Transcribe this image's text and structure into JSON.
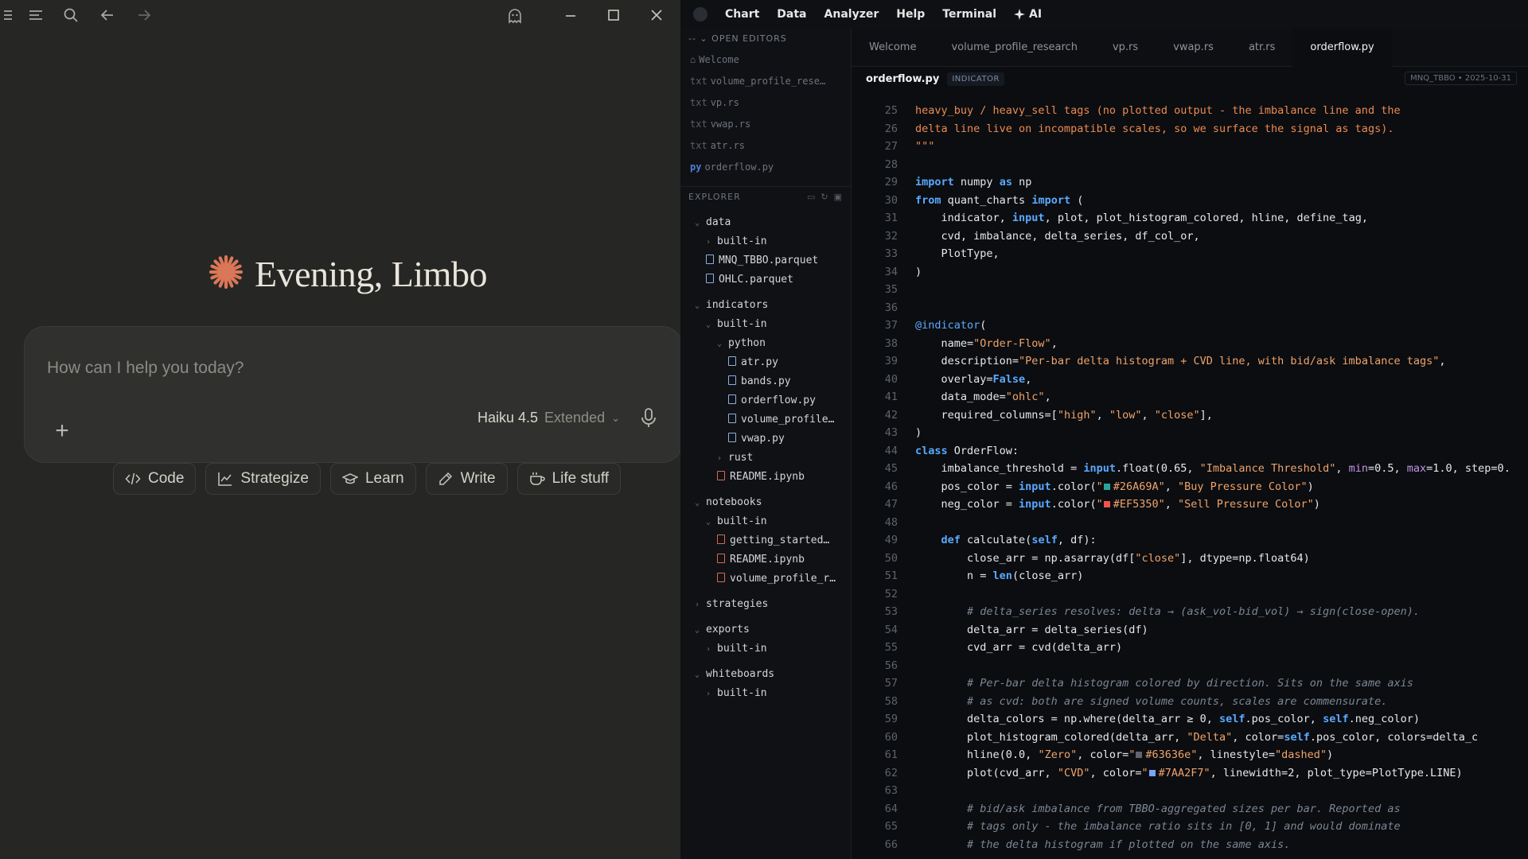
{
  "chat": {
    "greeting": "Evening, Limbo",
    "composer_placeholder": "How can I help you today?",
    "model_name": "Haiku 4.5",
    "model_mode": "Extended",
    "chips": [
      "Code",
      "Strategize",
      "Learn",
      "Write",
      "Life stuff"
    ],
    "accent_color": "#d97757"
  },
  "ide": {
    "menu": [
      "Chart",
      "Data",
      "Analyzer",
      "Help",
      "Terminal",
      "AI"
    ],
    "open_editors_label": "OPEN EDITORS",
    "open_editors": [
      {
        "prefix": "",
        "name": "Welcome"
      },
      {
        "prefix": "txt",
        "name": "volume_profile_rese…"
      },
      {
        "prefix": "txt",
        "name": "vp.rs"
      },
      {
        "prefix": "txt",
        "name": "vwap.rs"
      },
      {
        "prefix": "txt",
        "name": "atr.rs"
      },
      {
        "prefix": "py",
        "name": "orderflow.py"
      }
    ],
    "explorer_label": "EXPLORER",
    "tree": [
      {
        "name": "data",
        "indent": 0,
        "kind": "folder",
        "open": true
      },
      {
        "name": "built-in",
        "indent": 1,
        "kind": "folder",
        "open": false
      },
      {
        "name": "MNQ_TBBO.parquet",
        "indent": 1,
        "kind": "file"
      },
      {
        "name": "OHLC.parquet",
        "indent": 1,
        "kind": "file"
      },
      {
        "name": "indicators",
        "indent": 0,
        "kind": "folder",
        "open": true
      },
      {
        "name": "built-in",
        "indent": 1,
        "kind": "folder",
        "open": true
      },
      {
        "name": "python",
        "indent": 2,
        "kind": "folder",
        "open": true
      },
      {
        "name": "atr.py",
        "indent": 3,
        "kind": "file"
      },
      {
        "name": "bands.py",
        "indent": 3,
        "kind": "file"
      },
      {
        "name": "orderflow.py",
        "indent": 3,
        "kind": "file"
      },
      {
        "name": "volume_profile…",
        "indent": 3,
        "kind": "file"
      },
      {
        "name": "vwap.py",
        "indent": 3,
        "kind": "file"
      },
      {
        "name": "rust",
        "indent": 2,
        "kind": "folder",
        "open": false
      },
      {
        "name": "README.ipynb",
        "indent": 2,
        "kind": "nb"
      },
      {
        "name": "notebooks",
        "indent": 0,
        "kind": "folder",
        "open": true
      },
      {
        "name": "built-in",
        "indent": 1,
        "kind": "folder",
        "open": true
      },
      {
        "name": "getting_started…",
        "indent": 2,
        "kind": "nb"
      },
      {
        "name": "README.ipynb",
        "indent": 2,
        "kind": "nb"
      },
      {
        "name": "volume_profile_r…",
        "indent": 2,
        "kind": "nb"
      },
      {
        "name": "strategies",
        "indent": 0,
        "kind": "folder",
        "open": false
      },
      {
        "name": "exports",
        "indent": 0,
        "kind": "folder",
        "open": true
      },
      {
        "name": "built-in",
        "indent": 1,
        "kind": "folder",
        "open": false
      },
      {
        "name": "whiteboards",
        "indent": 0,
        "kind": "folder",
        "open": true
      },
      {
        "name": "built-in",
        "indent": 1,
        "kind": "folder",
        "open": false
      }
    ],
    "tabs": [
      "Welcome",
      "volume_profile_research",
      "vp.rs",
      "vwap.rs",
      "atr.rs",
      "orderflow.py"
    ],
    "active_tab": "orderflow.py",
    "breadcrumb_file": "orderflow.py",
    "breadcrumb_badge": "INDICATOR",
    "breadcrumb_meta": "MNQ_TBBO • 2025-10-31",
    "code_start_line": 25,
    "code_lines": [
      [
        [
          "doc",
          "heavy_buy / heavy_sell tags (no plotted output - the imbalance line and the"
        ]
      ],
      [
        [
          "doc",
          "delta line live on incompatible scales, so we surface the signal as tags)."
        ]
      ],
      [
        [
          "doc",
          "\"\"\""
        ]
      ],
      [],
      [
        [
          "k",
          "import"
        ],
        [
          "t",
          " numpy "
        ],
        [
          "k",
          "as"
        ],
        [
          "t",
          " np"
        ]
      ],
      [
        [
          "k",
          "from"
        ],
        [
          "t",
          " quant_charts "
        ],
        [
          "k",
          "import"
        ],
        [
          "t",
          " ("
        ]
      ],
      [
        [
          "t",
          "    indicator, "
        ],
        [
          "k",
          "input"
        ],
        [
          "t",
          ", plot, plot_histogram_colored, hline, define_tag,"
        ]
      ],
      [
        [
          "t",
          "    cvd, imbalance, delta_series, df_col_or,"
        ]
      ],
      [
        [
          "t",
          "    PlotType,"
        ]
      ],
      [
        [
          "t",
          ")"
        ]
      ],
      [],
      [],
      [
        [
          "dec",
          "@indicator"
        ],
        [
          "t",
          "("
        ]
      ],
      [
        [
          "t",
          "    name="
        ],
        [
          "s",
          "\"Order-Flow\""
        ],
        [
          "t",
          ","
        ]
      ],
      [
        [
          "t",
          "    description="
        ],
        [
          "s",
          "\"Per-bar delta histogram + CVD line, with bid/ask imbalance tags\""
        ],
        [
          "t",
          ","
        ]
      ],
      [
        [
          "t",
          "    overlay="
        ],
        [
          "k",
          "False"
        ],
        [
          "t",
          ","
        ]
      ],
      [
        [
          "t",
          "    data_mode="
        ],
        [
          "s",
          "\"ohlc\""
        ],
        [
          "t",
          ","
        ]
      ],
      [
        [
          "t",
          "    required_columns=["
        ],
        [
          "s",
          "\"high\""
        ],
        [
          "t",
          ", "
        ],
        [
          "s",
          "\"low\""
        ],
        [
          "t",
          ", "
        ],
        [
          "s",
          "\"close\""
        ],
        [
          "t",
          "],"
        ]
      ],
      [
        [
          "t",
          ")"
        ]
      ],
      [
        [
          "k",
          "class"
        ],
        [
          "t",
          " OrderFlow:"
        ]
      ],
      [
        [
          "t",
          "    imbalance_threshold = "
        ],
        [
          "k",
          "input"
        ],
        [
          "t",
          ".float(0.65, "
        ],
        [
          "s",
          "\"Imbalance Threshold\""
        ],
        [
          "t",
          ", "
        ],
        [
          "kw",
          "min"
        ],
        [
          "t",
          "=0.5, "
        ],
        [
          "kw",
          "max"
        ],
        [
          "t",
          "=1.0, step=0."
        ]
      ],
      [
        [
          "t",
          "    pos_color = "
        ],
        [
          "k",
          "input"
        ],
        [
          "t",
          ".color("
        ],
        [
          "s",
          "\""
        ],
        [
          "sw",
          "#26A69A"
        ],
        [
          "s",
          "#26A69A\""
        ],
        [
          "t",
          ", "
        ],
        [
          "s",
          "\"Buy Pressure Color\""
        ],
        [
          "t",
          ")"
        ]
      ],
      [
        [
          "t",
          "    neg_color = "
        ],
        [
          "k",
          "input"
        ],
        [
          "t",
          ".color("
        ],
        [
          "s",
          "\""
        ],
        [
          "sw",
          "#EF5350"
        ],
        [
          "s",
          "#EF5350\""
        ],
        [
          "t",
          ", "
        ],
        [
          "s",
          "\"Sell Pressure Color\""
        ],
        [
          "t",
          ")"
        ]
      ],
      [],
      [
        [
          "t",
          "    "
        ],
        [
          "k",
          "def"
        ],
        [
          "t",
          " calculate("
        ],
        [
          "k",
          "self"
        ],
        [
          "t",
          ", df):"
        ]
      ],
      [
        [
          "t",
          "        close_arr = np.asarray(df["
        ],
        [
          "s",
          "\"close\""
        ],
        [
          "t",
          "], dtype=np.float64)"
        ]
      ],
      [
        [
          "t",
          "        n = "
        ],
        [
          "k",
          "len"
        ],
        [
          "t",
          "(close_arr)"
        ]
      ],
      [],
      [
        [
          "c",
          "        # delta_series resolves: delta → (ask_vol-bid_vol) → sign(close-open)."
        ]
      ],
      [
        [
          "t",
          "        delta_arr = delta_series(df)"
        ]
      ],
      [
        [
          "t",
          "        cvd_arr = cvd(delta_arr)"
        ]
      ],
      [],
      [
        [
          "c",
          "        # Per-bar delta histogram colored by direction. Sits on the same axis"
        ]
      ],
      [
        [
          "c",
          "        # as cvd: both are signed volume counts, scales are commensurate."
        ]
      ],
      [
        [
          "t",
          "        delta_colors = np.where(delta_arr ≥ 0, "
        ],
        [
          "k",
          "self"
        ],
        [
          "t",
          ".pos_color, "
        ],
        [
          "k",
          "self"
        ],
        [
          "t",
          ".neg_color)"
        ]
      ],
      [
        [
          "t",
          "        plot_histogram_colored(delta_arr, "
        ],
        [
          "s",
          "\"Delta\""
        ],
        [
          "t",
          ", color="
        ],
        [
          "k",
          "self"
        ],
        [
          "t",
          ".pos_color, colors=delta_c"
        ]
      ],
      [
        [
          "t",
          "        hline(0.0, "
        ],
        [
          "s",
          "\"Zero\""
        ],
        [
          "t",
          ", color="
        ],
        [
          "s",
          "\""
        ],
        [
          "sw",
          "#63636e"
        ],
        [
          "s",
          "#63636e\""
        ],
        [
          "t",
          ", linestyle="
        ],
        [
          "s",
          "\"dashed\""
        ],
        [
          "t",
          ")"
        ]
      ],
      [
        [
          "t",
          "        plot(cvd_arr, "
        ],
        [
          "s",
          "\"CVD\""
        ],
        [
          "t",
          ", color="
        ],
        [
          "s",
          "\""
        ],
        [
          "sw",
          "#7AA2F7"
        ],
        [
          "s",
          "#7AA2F7\""
        ],
        [
          "t",
          ", linewidth=2, plot_type=PlotType.LINE)"
        ]
      ],
      [],
      [
        [
          "c",
          "        # bid/ask imbalance from TBBO-aggregated sizes per bar. Reported as"
        ]
      ],
      [
        [
          "c",
          "        # tags only - the imbalance ratio sits in [0, 1] and would dominate"
        ]
      ],
      [
        [
          "c",
          "        # the delta histogram if plotted on the same axis."
        ]
      ]
    ]
  }
}
